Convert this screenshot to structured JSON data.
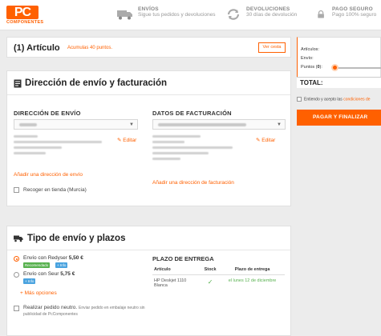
{
  "header": {
    "logo_text": "PC",
    "logo_sub": "COMPONENTES",
    "features": [
      {
        "title": "ENVÍOS",
        "subtitle": "Sigue tus pedidos y devoluciones",
        "icon": "truck-icon"
      },
      {
        "title": "DEVOLUCIONES",
        "subtitle": "30 días de devolución",
        "icon": "return-icon"
      },
      {
        "title": "PAGO SEGURO",
        "subtitle": "Pago 100% seguro",
        "icon": "lock-icon"
      }
    ]
  },
  "articulo": {
    "title": "(1) Artículo",
    "points_note": "Acumulas 40 puntos.",
    "view_button": "Ver cesta"
  },
  "envio": {
    "title": "Dirección de envío y facturación",
    "shipping_label": "DIRECCIÓN DE ENVÍO",
    "billing_label": "DATOS DE FACTURACIÓN",
    "edit_label": "Editar",
    "add_shipping": "Añadir una dirección de envío",
    "add_billing": "Añadir una dirección de facturación",
    "pickup_label": "Recoger en tienda (Murcia)"
  },
  "tipo": {
    "title": "Tipo de envío y plazos",
    "options": [
      {
        "name": "Envío con Redyser",
        "price": "5,50 €",
        "badges": [
          "Recomendado",
          "+ Info"
        ],
        "selected": true
      },
      {
        "name": "Envío con Seur",
        "price": "5,75 €",
        "badges": [
          "+ Info"
        ],
        "selected": false
      }
    ],
    "more_options": "Más opciones",
    "neutral_title": "Realizar pedido neutro.",
    "neutral_desc": "Enviar pedido en embalaje neutro sin publicidad de PcComponentes",
    "plazo_title": "PLAZO DE ENTREGA",
    "table_headers": [
      "Artículo",
      "Stock",
      "Plazo de entrega"
    ],
    "table_rows": [
      {
        "article": "HP Deskjet 1110 Blanca",
        "stock": "✓",
        "delivery": "el lunes 12 de diciembre"
      }
    ]
  },
  "summary": {
    "articles_label": "Artículos:",
    "shipping_label": "Envío:",
    "points_label": "Puntos (",
    "points_value": "0",
    "points_suffix": "):",
    "total_label": "TOTAL:",
    "terms_text": "Entiendo y acepto las",
    "terms_link": "condiciones de",
    "pay_button": "PAGAR Y FINALIZAR"
  },
  "colors": {
    "accent": "#ff6000",
    "success": "#58b14f",
    "info": "#4aa3df"
  }
}
